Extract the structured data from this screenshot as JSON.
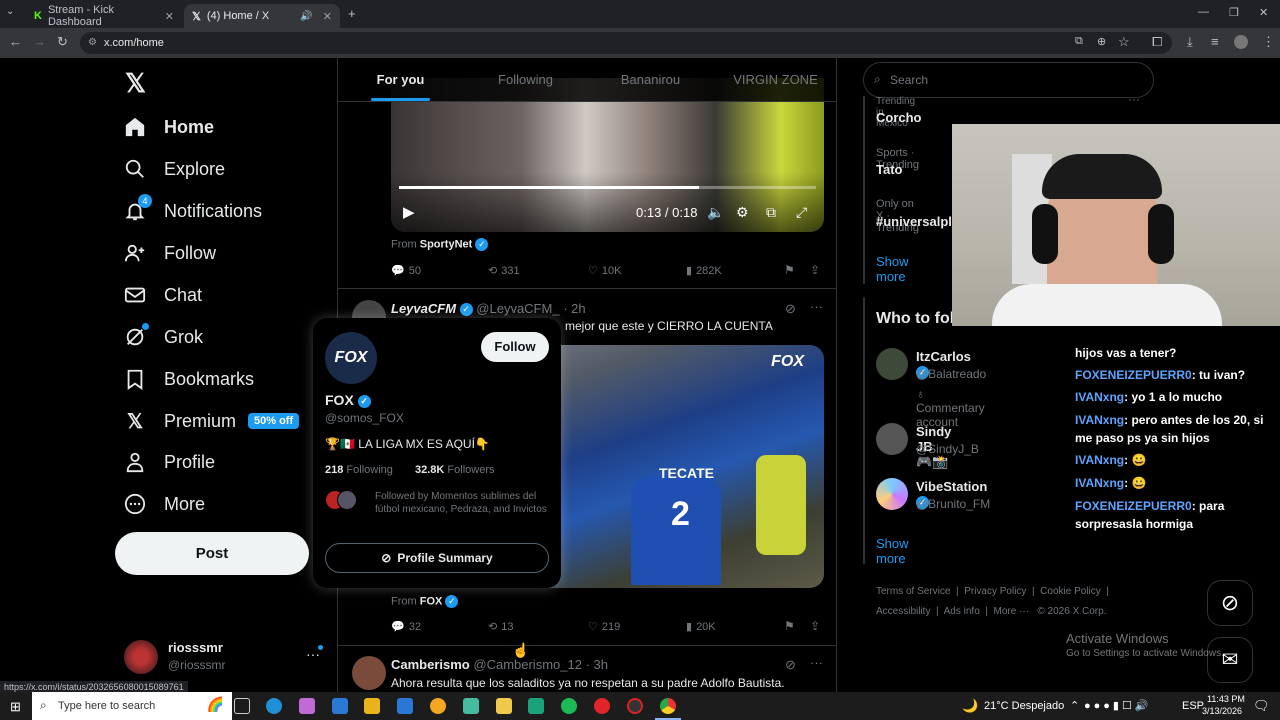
{
  "browser": {
    "tabs": [
      {
        "label": "Stream - Kick Dashboard",
        "active": false
      },
      {
        "label": "(4) Home / X",
        "active": true
      }
    ],
    "url": "x.com/home",
    "status_url": "https://x.com/i/status/2032656080015089761"
  },
  "nav": {
    "home": "Home",
    "explore": "Explore",
    "notifications": "Notifications",
    "notif_count": "4",
    "follow": "Follow",
    "chat": "Chat",
    "grok": "Grok",
    "bookmarks": "Bookmarks",
    "premium": "Premium",
    "premium_badge": "50% off",
    "profile": "Profile",
    "more": "More",
    "post": "Post"
  },
  "account": {
    "name": "riosssmr",
    "handle": "@riosssmr"
  },
  "feed": {
    "tabs": [
      "For you",
      "Following",
      "Bananirou",
      "VIRGIN ZONE"
    ],
    "video": {
      "time": "0:13 / 0:18",
      "from_label": "From",
      "from": "SportyNet"
    },
    "post1_stats": {
      "replies": "50",
      "reposts": "331",
      "likes": "10K",
      "views": "282K"
    },
    "post2": {
      "name": "LeyvaCFM",
      "handle": "@LeyvaCFM_",
      "time": "· 2h",
      "text_partial": "mejor que este y CIERRO LA CUENTA",
      "overlay_logo": "FOX",
      "from": "FOX",
      "replies": "32",
      "reposts": "13",
      "likes": "219",
      "views": "20K"
    },
    "post3": {
      "name": "Camberismo",
      "handle": "@Camberismo_12",
      "time": "· 3h",
      "text": "Ahora resulta que los saladitos ya no respetan a su padre Adolfo Bautista."
    }
  },
  "hovercard": {
    "logo": "FOX",
    "name": "FOX",
    "handle": "@somos_FOX",
    "bio": "🏆🇲🇽 LA LIGA MX ES AQUÍ👇",
    "following_count": "218",
    "following_label": "Following",
    "followers_count": "32.8K",
    "followers_label": "Followers",
    "followed_by": "Followed by Momentos sublimes del fútbol mexicano, Pedraza, and Invictos",
    "follow_btn": "Follow",
    "summary_btn": "Profile Summary"
  },
  "right": {
    "search_placeholder": "Search",
    "trends": [
      {
        "context": "Trending in Mexico",
        "name": "Corcho"
      },
      {
        "context": "Sports · Trending",
        "name": "Tato"
      },
      {
        "context": "Only on X · Trending",
        "name": "#universalpl"
      }
    ],
    "show_more": "Show more",
    "who_to_follow": "Who to follow",
    "suggestions": [
      {
        "name": "ItzCarlos",
        "handle": "@Balatreado",
        "note": "Commentary account"
      },
      {
        "name": "Sindy JB 🎮📸",
        "handle": "@SindyJ_B",
        "note": ""
      },
      {
        "name": "VibeStation",
        "handle": "@Brunito_FM",
        "note": ""
      }
    ],
    "show_more2": "Show more",
    "footer": [
      "Terms of Service",
      "Privacy Policy",
      "Cookie Policy",
      "Accessibility",
      "Ads info",
      "More ···",
      "© 2026 X Corp."
    ]
  },
  "chat": [
    {
      "user": "",
      "text": "hijos vas a tener?"
    },
    {
      "user": "FOXENEIZEPUERR0",
      "text": ": tu ivan?"
    },
    {
      "user": "IVANxng",
      "text": ": yo 1 a lo mucho"
    },
    {
      "user": "IVANxng",
      "text": ": pero antes de los 20, si me paso ps ya sin hijos"
    },
    {
      "user": "IVANxng",
      "text": ": 😀"
    },
    {
      "user": "IVANxng",
      "text": ": 😀"
    },
    {
      "user": "FOXENEIZEPUERR0",
      "text": ": para sorpresasla hormiga"
    }
  ],
  "windows": {
    "activate": "Activate Windows",
    "activate_sub": "Go to Settings to activate Windows."
  },
  "taskbar": {
    "search": "Type here to search",
    "weather": "21°C  Despejado",
    "lang": "ESP",
    "time": "11:43 PM",
    "date": "3/13/2026"
  },
  "colors": {
    "accent": "#1d9bf0",
    "bg": "#000000",
    "premium": "#1d9bf0"
  }
}
